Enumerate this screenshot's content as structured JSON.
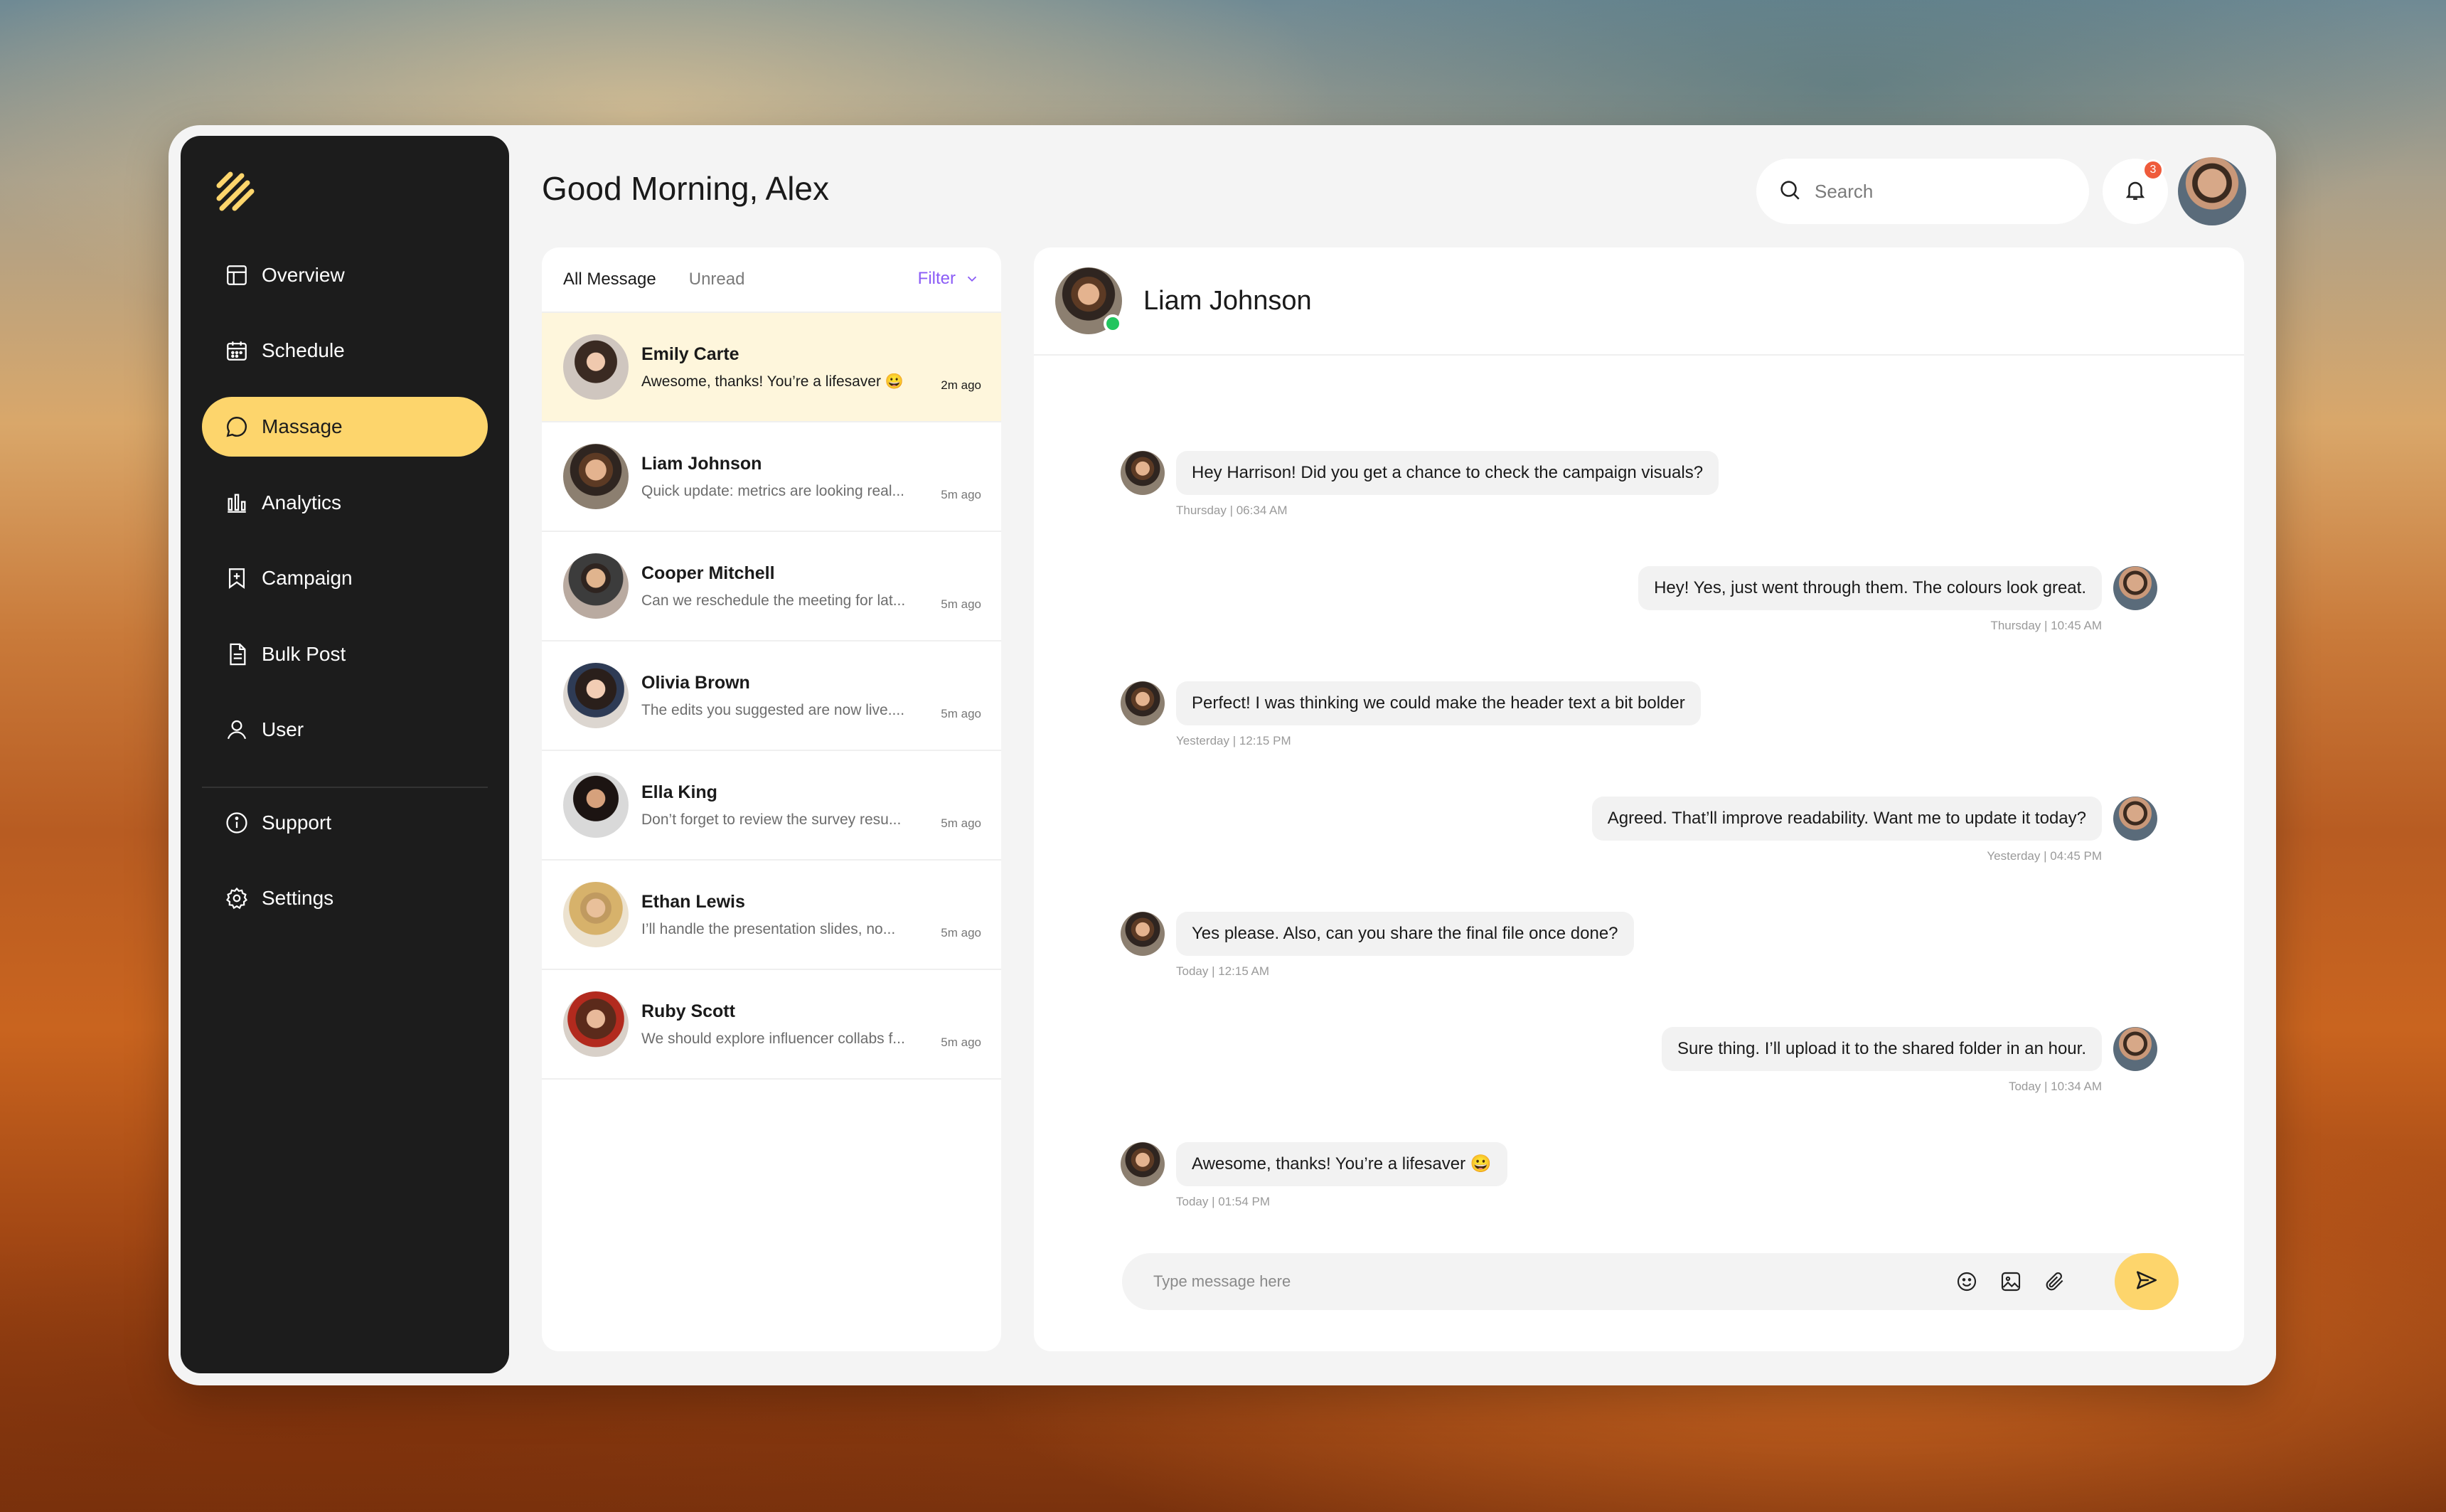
{
  "header": {
    "greeting": "Good Morning, Alex",
    "search_placeholder": "Search",
    "notification_count": "3"
  },
  "sidebar": {
    "items": [
      {
        "label": "Overview",
        "icon": "layout-icon"
      },
      {
        "label": "Schedule",
        "icon": "calendar-icon"
      },
      {
        "label": "Massage",
        "icon": "chat-bubble-icon",
        "active": true
      },
      {
        "label": "Analytics",
        "icon": "bar-chart-icon"
      },
      {
        "label": "Campaign",
        "icon": "bookmark-icon"
      },
      {
        "label": "Bulk Post",
        "icon": "document-icon"
      },
      {
        "label": "User",
        "icon": "user-icon"
      }
    ],
    "footer_items": [
      {
        "label": "Support",
        "icon": "info-icon"
      },
      {
        "label": "Settings",
        "icon": "gear-icon"
      }
    ]
  },
  "message_list": {
    "tabs": [
      "All Message",
      "Unread"
    ],
    "filter_label": "Filter",
    "conversations": [
      {
        "name": "Emily Carte",
        "preview": "Awesome, thanks! You’re a lifesaver 😀",
        "time": "2m ago",
        "active": true
      },
      {
        "name": "Liam Johnson",
        "preview": "Quick update: metrics are looking real...",
        "time": "5m ago"
      },
      {
        "name": "Cooper Mitchell",
        "preview": "Can we reschedule the meeting for lat...",
        "time": "5m ago"
      },
      {
        "name": "Olivia Brown",
        "preview": "The edits you suggested are now live....",
        "time": "5m ago"
      },
      {
        "name": "Ella King",
        "preview": "Don’t forget to review the survey resu...",
        "time": "5m ago"
      },
      {
        "name": "Ethan Lewis",
        "preview": "I’ll handle the presentation slides, no...",
        "time": "5m ago"
      },
      {
        "name": "Ruby Scott",
        "preview": "We should explore influencer collabs f...",
        "time": "5m ago"
      }
    ]
  },
  "chat": {
    "contact_name": "Liam Johnson",
    "messages": [
      {
        "from": "them",
        "text": "Hey Harrison! Did you get a chance to check the campaign visuals?",
        "stamp": "Thursday | 06:34 AM"
      },
      {
        "from": "me",
        "text": "Hey! Yes, just went through them. The colours look great.",
        "stamp": "Thursday | 10:45 AM"
      },
      {
        "from": "them",
        "text": "Perfect! I was thinking we could make the header text a bit bolder",
        "stamp": "Yesterday | 12:15 PM"
      },
      {
        "from": "me",
        "text": "Agreed. That’ll improve readability. Want me to update it today?",
        "stamp": "Yesterday | 04:45 PM"
      },
      {
        "from": "them",
        "text": "Yes please. Also, can you share the final file once done?",
        "stamp": "Today | 12:15 AM"
      },
      {
        "from": "me",
        "text": "Sure thing. I’ll upload it to the shared folder in an hour.",
        "stamp": "Today | 10:34 AM"
      },
      {
        "from": "them",
        "text": "Awesome, thanks! You’re a lifesaver 😀",
        "stamp": "Today | 01:54 PM"
      }
    ],
    "input_placeholder": "Type message here"
  },
  "colors": {
    "accent": "#fdd56c",
    "sidebar_bg": "#1c1c1c",
    "filter": "#8b5cf6",
    "online": "#22c55e",
    "badge": "#ef5b3b"
  }
}
